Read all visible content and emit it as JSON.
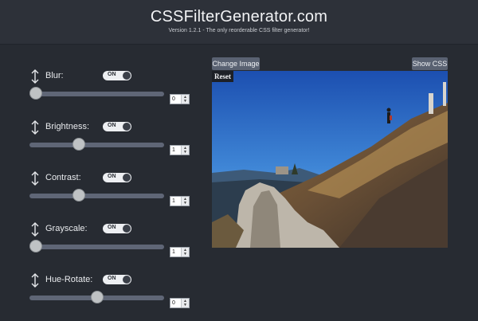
{
  "header": {
    "title": "CSSFilterGenerator.com",
    "subtitle": "Version 1.2.1 - The only reorderable CSS filter generator!"
  },
  "buttons": {
    "change_image": "Change Image",
    "show_css": "Show CSS",
    "reset": "Reset"
  },
  "filters": [
    {
      "label": "Blur:",
      "toggle": "ON",
      "value": "0",
      "slider_fraction": 0.0
    },
    {
      "label": "Brightness:",
      "toggle": "ON",
      "value": "1",
      "slider_fraction": 0.35
    },
    {
      "label": "Contrast:",
      "toggle": "ON",
      "value": "1",
      "slider_fraction": 0.35
    },
    {
      "label": "Grayscale:",
      "toggle": "ON",
      "value": "1",
      "slider_fraction": 0.0
    },
    {
      "label": "Hue-Rotate:",
      "toggle": "ON",
      "value": "0",
      "slider_fraction": 0.5
    }
  ],
  "colors": {
    "background": "#272b32",
    "header": "#2d3139",
    "button": "#5a6272",
    "track": "#5f6676"
  },
  "icons": {
    "sort": "sort-vertical-icon",
    "spinner_up": "caret-up-icon",
    "spinner_down": "caret-down-icon"
  }
}
